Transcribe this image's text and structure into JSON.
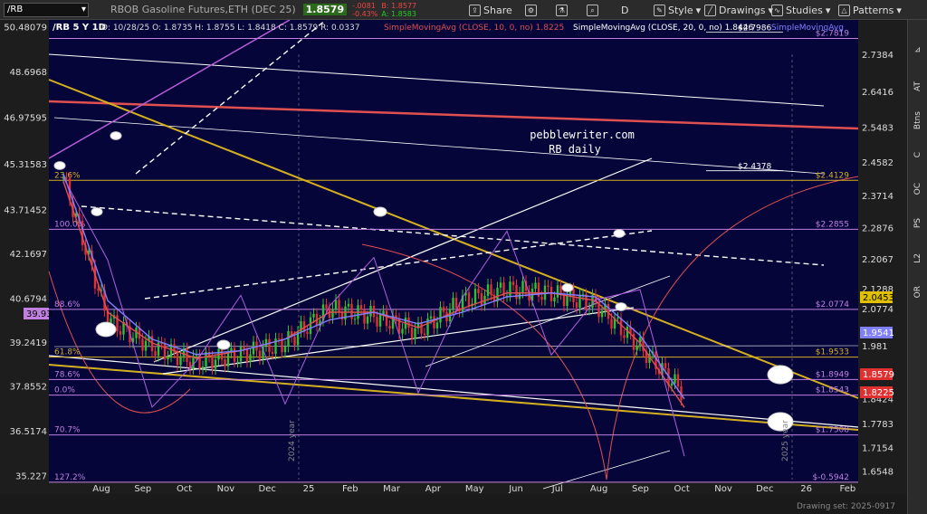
{
  "toolbar": {
    "symbol": "/RB",
    "name": "RBOB Gasoline Futures,ETH (DEC 25)",
    "last": "1.8579",
    "change": "-.0081",
    "change_pct": "-0.43%",
    "bid": "B: 1.8577",
    "ask": "A: 1.8583",
    "share": "Share",
    "d_label": "D",
    "style": "Style",
    "drawings": "Drawings",
    "studies": "Studies",
    "patterns": "Patterns"
  },
  "header": {
    "symbol_period": "/RB 5 Y 1D",
    "ohlc": "D: 10/28/25   O: 1.8735   H: 1.8755   L: 1.8418   C: 1.8579   R: 0.0337",
    "sma10": "SimpleMovingAvg (CLOSE, 10, 0, no)  1.8225",
    "sma20": "SimpleMovingAvg (CLOSE, 20, 0, no)  1.8446",
    "sma_more": "SimpleMovingAvg"
  },
  "watermark": {
    "line1": "pebblewriter.com",
    "line2": "RB daily"
  },
  "colors": {
    "bg": "#05053a",
    "fib": "#c080e0",
    "yellow": "#d4b020",
    "red": "#e05050",
    "up": "#30c030",
    "down": "#e03030",
    "blue_ma": "#8080ff",
    "accent_green": "#2a6a1a"
  },
  "left_axis": [
    {
      "label": "50.48079",
      "v": 2.81
    },
    {
      "label": "48.6968",
      "v": 2.694
    },
    {
      "label": "46.97595",
      "v": 2.575
    },
    {
      "label": "45.31583",
      "v": 2.453
    },
    {
      "label": "43.71452",
      "v": 2.335
    },
    {
      "label": "42.1697",
      "v": 2.221
    },
    {
      "label": "40.6794",
      "v": 2.104
    },
    {
      "label": "39.2419",
      "v": 1.99
    },
    {
      "label": "37.8552",
      "v": 1.876
    },
    {
      "label": "36.5174",
      "v": 1.76
    },
    {
      "label": "35.227",
      "v": 1.643
    }
  ],
  "right_axis": [
    "2.7384",
    "2.6416",
    "2.5483",
    "2.4582",
    "2.3714",
    "2.2876",
    "2.2067",
    "2.1288",
    "2.0774",
    "1.981",
    "1.911",
    "1.8424",
    "1.7783",
    "1.7154",
    "1.6548"
  ],
  "right_axis_values": [
    2.7384,
    2.6416,
    2.5483,
    2.4582,
    2.3714,
    2.2876,
    2.2067,
    2.1288,
    2.0774,
    1.981,
    1.911,
    1.8424,
    1.7783,
    1.7154,
    1.6548
  ],
  "fib_levels": [
    {
      "pct": "",
      "val": "$2.7819",
      "v": 2.7819
    },
    {
      "pct": "23.6%",
      "val": "$2.4129",
      "v": 2.4129
    },
    {
      "pct": "100.0%",
      "val": "$2.2855",
      "v": 2.2855
    },
    {
      "pct": "88.6%",
      "val": "$2.0774",
      "v": 2.0774
    },
    {
      "pct": "61.8%",
      "val": "$1.9533",
      "v": 1.9533
    },
    {
      "pct": "78.6%",
      "val": "$1.8949",
      "v": 1.8949
    },
    {
      "pct": "0.0%",
      "val": "$1.8543",
      "v": 1.8543
    },
    {
      "pct": "70.7%",
      "val": "$1.7508",
      "v": 1.7508
    },
    {
      "pct": "127.2%",
      "val": "$-0.5942",
      "v": 1.628
    }
  ],
  "white_labels": [
    {
      "val": "$2.7986",
      "v": 2.7986
    },
    {
      "val": "$2.4378",
      "v": 2.4378
    }
  ],
  "badges": {
    "left": "39.93",
    "price": "2.0453",
    "sma20": "1.9541",
    "last": "1.8579",
    "sma10": "1.8225"
  },
  "x_axis": [
    "Aug",
    "Sep",
    "Oct",
    "Nov",
    "Dec",
    "25",
    "Feb",
    "Mar",
    "Apr",
    "May",
    "Jun",
    "Jul",
    "Aug",
    "Sep",
    "Oct",
    "Nov",
    "Dec",
    "26",
    "Feb"
  ],
  "year_labels": [
    "2024 year",
    "2025 year"
  ],
  "sidebar": [
    "AT",
    "Btns",
    "C",
    "OC",
    "PS",
    "L2",
    "OR"
  ],
  "drawing_set": "Drawing set: 2025-0917",
  "chart_data": {
    "type": "line",
    "title": "RBOB Gasoline Futures,ETH (DEC 25)",
    "x": [
      "Aug",
      "Sep",
      "Oct",
      "Nov",
      "Dec",
      "25",
      "Feb",
      "Mar",
      "Apr",
      "May",
      "Jun",
      "Jul",
      "Aug",
      "Sep",
      "Oct"
    ],
    "series": [
      {
        "name": "RBOB Gasoline Futures,ETH (DEC 25)",
        "values": [
          2.42,
          2.05,
          1.98,
          1.94,
          1.96,
          1.99,
          2.08,
          2.06,
          2.02,
          2.1,
          2.13,
          2.12,
          2.09,
          1.98,
          1.858
        ]
      },
      {
        "name": "SimpleMovingAvg (CLOSE, 10, 0, no)",
        "values": [
          2.41,
          2.07,
          1.99,
          1.95,
          1.97,
          2.0,
          2.07,
          2.07,
          2.03,
          2.08,
          2.12,
          2.12,
          2.1,
          1.99,
          1.8225
        ]
      },
      {
        "name": "SimpleMovingAvg (CLOSE, 20, 0, no)",
        "values": [
          2.43,
          2.1,
          2.0,
          1.96,
          1.97,
          2.0,
          2.05,
          2.07,
          2.04,
          2.07,
          2.11,
          2.12,
          2.11,
          2.01,
          1.8446
        ]
      }
    ],
    "ylim": [
      1.63,
      2.83
    ],
    "grid": false,
    "legend": "top"
  }
}
